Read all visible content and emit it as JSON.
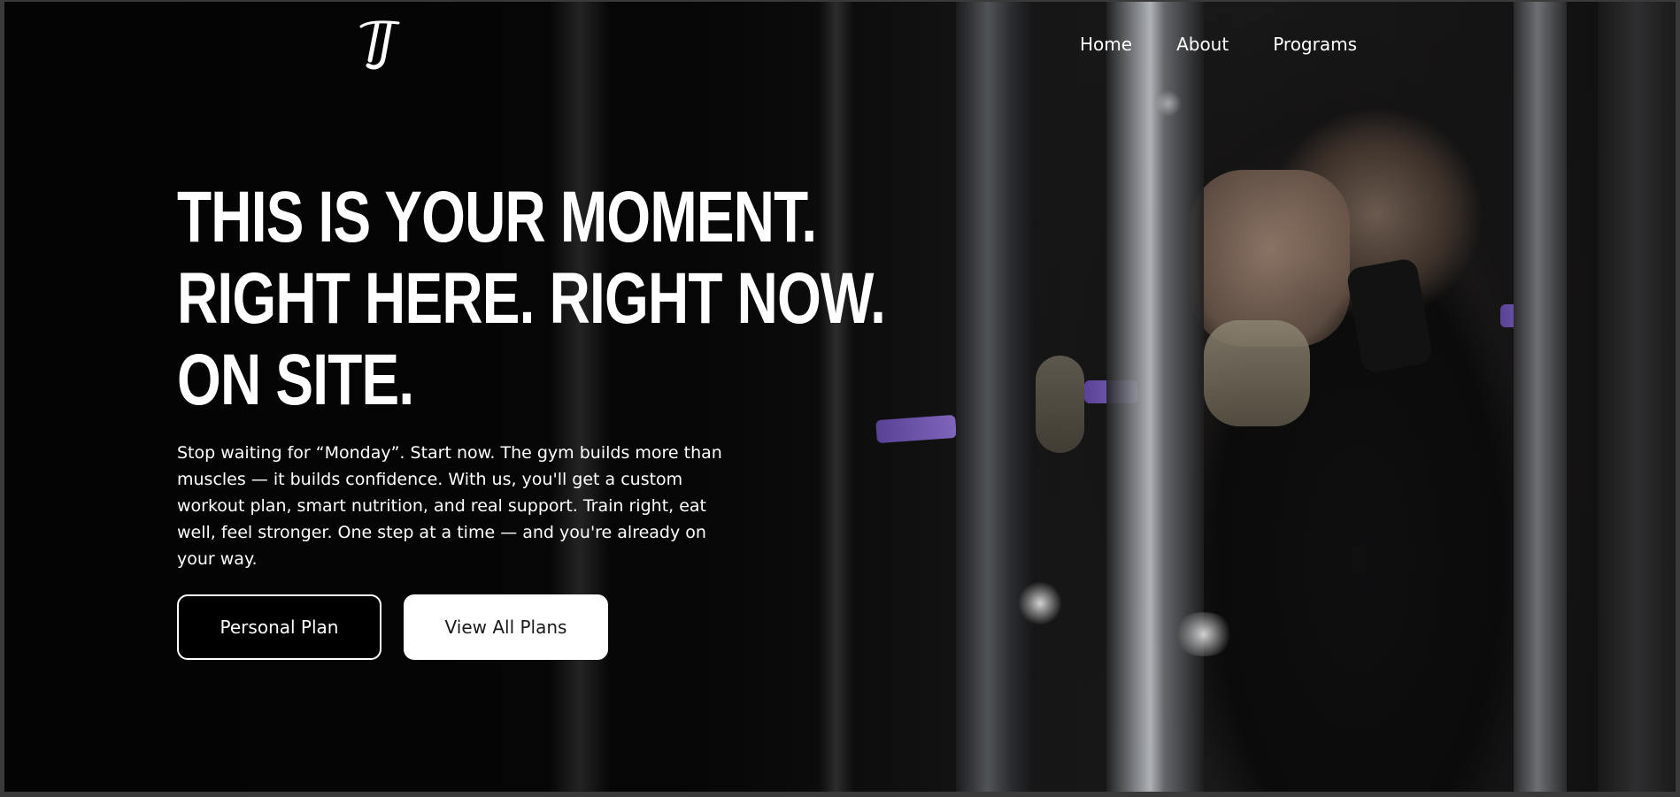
{
  "brand": {
    "logo_text": "TJ"
  },
  "nav": {
    "items": [
      {
        "label": "Home"
      },
      {
        "label": "About"
      },
      {
        "label": "Programs"
      }
    ]
  },
  "hero": {
    "headline": [
      "THIS IS YOUR MOMENT.",
      "RIGHT HERE. RIGHT NOW.",
      "ON SITE."
    ],
    "body": "Stop waiting for “Monday”. Start now. The gym builds more than muscles — it builds confidence. With us, you'll get a custom workout plan, smart nutrition, and real support. Train right, eat well, feel stronger. One step at a time — and you're already on your way.",
    "primary_button": "Personal Plan",
    "secondary_button": "View All Plans"
  },
  "colors": {
    "background": "#050505",
    "text": "#ffffff",
    "accent_purple": "#8b6be0"
  }
}
